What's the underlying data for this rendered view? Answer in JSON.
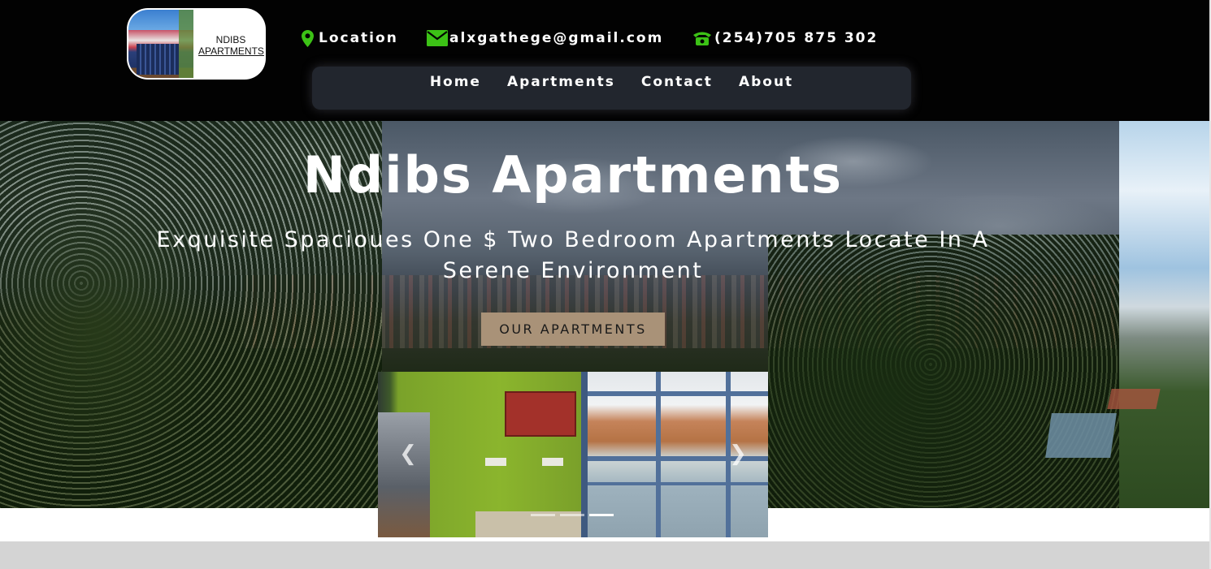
{
  "logo": {
    "line1": "NDIBS",
    "line2": "APARTMENTS"
  },
  "contact": {
    "location": "Location",
    "email": "alxgathege@gmail.com",
    "phone": "(254)705 875 302"
  },
  "nav": {
    "items": [
      "Home",
      "Apartments",
      "Contact",
      "About"
    ]
  },
  "hero": {
    "title": "Ndibs Apartments",
    "subtitle": "Exquisite Spacioues One $ Two Bedroom Apartments Locate In A Serene Environment",
    "button": "OUR APARTMENTS"
  },
  "carousel": {
    "prev_icon": "chevron-left-icon",
    "next_icon": "chevron-right-icon",
    "slide_count": 3,
    "active_slide": 3
  },
  "colors": {
    "header_bg": "#020202",
    "nav_bg": "#22262e",
    "icon_green": "#3cc216",
    "button_bg": "#a99278",
    "band_gray": "#d4d4d4"
  }
}
